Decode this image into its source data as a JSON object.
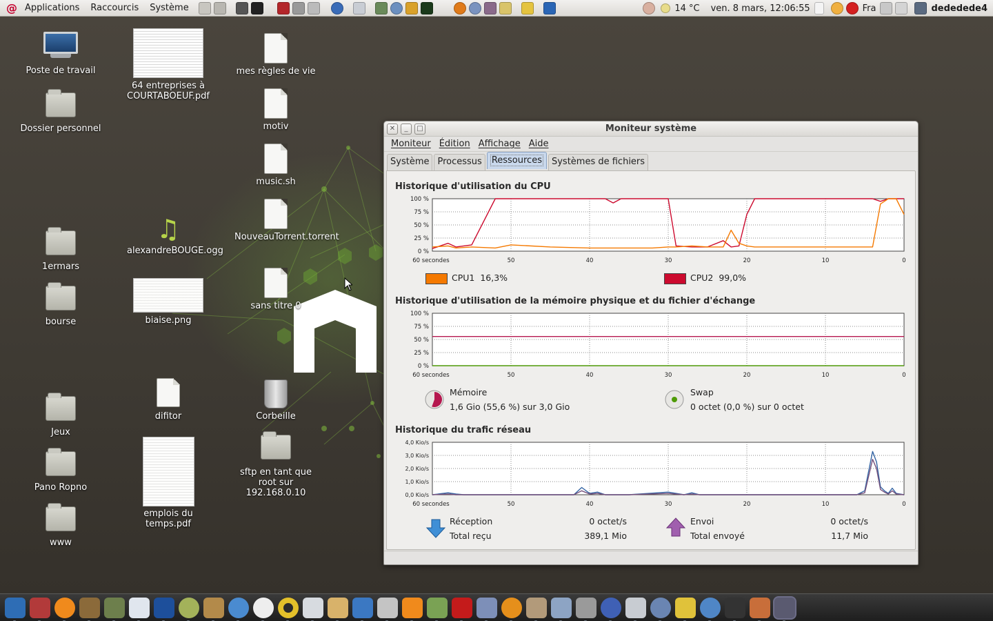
{
  "top_panel": {
    "menus": [
      "Applications",
      "Raccourcis",
      "Système"
    ],
    "weather": "14 °C",
    "clock": "ven.  8 mars, 12:06:55",
    "keyboard_layout": "Fra",
    "user": "dededede4"
  },
  "desktop": {
    "icons": [
      {
        "label": "Poste de travail",
        "kind": "computer-icon"
      },
      {
        "label": "Dossier personnel",
        "kind": "home-folder-icon"
      },
      {
        "label": "1ermars",
        "kind": "folder-icon"
      },
      {
        "label": "bourse",
        "kind": "folder-icon"
      },
      {
        "label": "Jeux",
        "kind": "folder-icon"
      },
      {
        "label": "Pano Ropno",
        "kind": "folder-icon"
      },
      {
        "label": "www",
        "kind": "folder-icon"
      },
      {
        "label": "64 entreprises à COURTABOEUF.pdf",
        "kind": "pdf-thumbnail"
      },
      {
        "label": "alexandreBOUGE.ogg",
        "kind": "audio-icon"
      },
      {
        "label": "biaise.png",
        "kind": "image-thumbnail"
      },
      {
        "label": "difitor",
        "kind": "document-icon"
      },
      {
        "label": "emplois du temps.pdf",
        "kind": "pdf-thumbnail"
      },
      {
        "label": "mes règles de vie",
        "kind": "document-icon"
      },
      {
        "label": "motiv",
        "kind": "document-icon"
      },
      {
        "label": "music.sh",
        "kind": "script-icon"
      },
      {
        "label": "NouveauTorrent.torrent",
        "kind": "torrent-icon"
      },
      {
        "label": "sans titre 0",
        "kind": "document-icon"
      },
      {
        "label": "Corbeille",
        "kind": "trash-icon"
      },
      {
        "label": "sftp en tant que root sur 192.168.0.10",
        "kind": "network-folder-icon"
      }
    ]
  },
  "window": {
    "title": "Moniteur système",
    "menus": [
      "Moniteur",
      "Édition",
      "Affichage",
      "Aide"
    ],
    "tabs": [
      "Système",
      "Processus",
      "Ressources",
      "Systèmes de fichiers"
    ],
    "active_tab": "Ressources",
    "cpu": {
      "title": "Historique d'utilisation du CPU",
      "y_ticks": [
        "100 %",
        "75 %",
        "50 %",
        "25 %",
        "0 %"
      ],
      "x_ticks": [
        "60 secondes",
        "50",
        "40",
        "30",
        "20",
        "10",
        "0"
      ],
      "cpu1_label": "CPU1",
      "cpu1_value": "16,3%",
      "cpu1_color": "#f57900",
      "cpu2_label": "CPU2",
      "cpu2_value": "99,0%",
      "cpu2_color": "#cc0a2e"
    },
    "memory": {
      "title": "Historique d'utilisation de la mémoire physique et du fichier d'échange",
      "y_ticks": [
        "100 %",
        "75 %",
        "50 %",
        "25 %",
        "0 %"
      ],
      "x_ticks": [
        "60 secondes",
        "50",
        "40",
        "30",
        "20",
        "10",
        "0"
      ],
      "mem_label": "Mémoire",
      "mem_value": "1,6 Gio (55,6 %) sur 3,0 Gio",
      "mem_color": "#b5174f",
      "swap_label": "Swap",
      "swap_value": "0 octet (0,0 %) sur 0 octet",
      "swap_color": "#4e9a06"
    },
    "network": {
      "title": "Historique du trafic réseau",
      "y_ticks": [
        "4,0 Kio/s",
        "3,0 Kio/s",
        "2,0 Kio/s",
        "1,0 Kio/s",
        "0,0 Kio/s"
      ],
      "x_ticks": [
        "60 secondes",
        "50",
        "40",
        "30",
        "20",
        "10",
        "0"
      ],
      "rx_label": "Réception",
      "rx_rate": "0 octet/s",
      "rx_total_label": "Total reçu",
      "rx_total": "389,1 Mio",
      "tx_label": "Envoi",
      "tx_rate": "0 octet/s",
      "tx_total_label": "Total envoyé",
      "tx_total": "11,7 Mio"
    }
  },
  "chart_data": [
    {
      "type": "line",
      "title": "Historique d'utilisation du CPU",
      "x": [
        60,
        58,
        57,
        55,
        52,
        50,
        45,
        40,
        38,
        37,
        36,
        35,
        32,
        30,
        29,
        27,
        25,
        23,
        22,
        21,
        20,
        19,
        18,
        16,
        10,
        5,
        4,
        3,
        2,
        1,
        0
      ],
      "xlim": [
        60,
        0
      ],
      "ylim": [
        0,
        100
      ],
      "series": [
        {
          "name": "CPU2",
          "color": "#cc0a2e",
          "values": [
            5,
            15,
            8,
            12,
            100,
            100,
            100,
            100,
            100,
            92,
            100,
            100,
            100,
            100,
            10,
            8,
            8,
            20,
            8,
            10,
            70,
            100,
            100,
            100,
            100,
            100,
            100,
            95,
            100,
            100,
            100
          ]
        },
        {
          "name": "CPU1",
          "color": "#f57900",
          "values": [
            8,
            10,
            6,
            8,
            6,
            12,
            8,
            6,
            6,
            6,
            6,
            6,
            6,
            8,
            8,
            10,
            8,
            8,
            40,
            15,
            10,
            8,
            8,
            8,
            8,
            8,
            8,
            90,
            100,
            100,
            70
          ]
        }
      ]
    },
    {
      "type": "line",
      "title": "Historique d'utilisation de la mémoire physique et du fichier d'échange",
      "xlim": [
        60,
        0
      ],
      "ylim": [
        0,
        100
      ],
      "x": [
        60,
        0
      ],
      "series": [
        {
          "name": "Mémoire",
          "color": "#b5174f",
          "values": [
            55.6,
            55.6
          ]
        },
        {
          "name": "Swap",
          "color": "#4e9a06",
          "values": [
            0,
            0
          ]
        }
      ]
    },
    {
      "type": "line",
      "title": "Historique du trafic réseau",
      "xlim": [
        60,
        0
      ],
      "ylim": [
        0,
        4
      ],
      "x": [
        60,
        58,
        57,
        56,
        50,
        45,
        42,
        41,
        40,
        39,
        38,
        35,
        30,
        28,
        27,
        26,
        25,
        20,
        10,
        6,
        5,
        4,
        3.5,
        3,
        2.5,
        2,
        1.5,
        1,
        0
      ],
      "series": [
        {
          "name": "Réception",
          "color": "#3465a4",
          "values": [
            0,
            0.15,
            0.05,
            0,
            0,
            0,
            0,
            0.55,
            0.1,
            0.2,
            0,
            0,
            0.2,
            0,
            0.15,
            0,
            0,
            0,
            0,
            0,
            0.3,
            3.3,
            2.5,
            0.6,
            0.3,
            0.1,
            0.5,
            0.1,
            0
          ]
        },
        {
          "name": "Envoi",
          "color": "#75507b",
          "values": [
            0,
            0.05,
            0,
            0,
            0,
            0,
            0,
            0.3,
            0.05,
            0.1,
            0,
            0,
            0.1,
            0,
            0.05,
            0,
            0,
            0,
            0,
            0,
            0.15,
            2.7,
            2.0,
            0.4,
            0.2,
            0.05,
            0.3,
            0.05,
            0
          ]
        }
      ]
    }
  ]
}
